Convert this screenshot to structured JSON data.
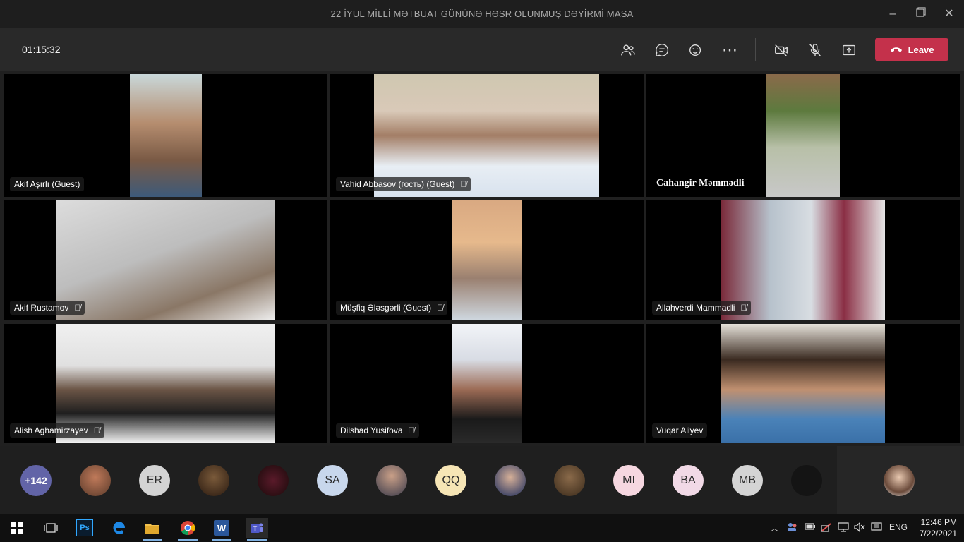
{
  "window": {
    "title": "22 İYUL MİLLİ MƏTBUAT GÜNÜNƏ HƏSR OLUNMUŞ DƏYİRMİ MASA",
    "minimize_icon": "minimize-icon",
    "restore_icon": "restore-icon",
    "close_icon": "close-icon"
  },
  "toolbar": {
    "timer": "01:15:32",
    "leave_label": "Leave",
    "leave_color": "#c4314b",
    "buttons": [
      "participants-icon",
      "chat-icon",
      "reactions-icon",
      "more-icon",
      "camera-off-icon",
      "mic-off-icon",
      "share-icon"
    ]
  },
  "tiles": [
    {
      "name": "Akif Aşırlı (Guest)",
      "muted": false
    },
    {
      "name": "Vahid Abbasov (гость) (Guest)",
      "muted": true
    },
    {
      "name": "Cahangir Məmmədli",
      "muted": false
    },
    {
      "name": "Akif Rustamov",
      "muted": true
    },
    {
      "name": "Müşfiq Ələsgərli (Guest)",
      "muted": true
    },
    {
      "name": "Allahverdi Mammadli",
      "muted": true
    },
    {
      "name": "Alish Aghamirzayev",
      "muted": true
    },
    {
      "name": "Dilshad Yusifova",
      "muted": true
    },
    {
      "name": "Vuqar Aliyev",
      "muted": false
    }
  ],
  "tray": {
    "overflow": "+142",
    "avatars": [
      "",
      "ER",
      "",
      "",
      "SA",
      "",
      "QQ",
      "",
      "",
      "MI",
      "BA",
      "MB",
      ""
    ]
  },
  "taskbar": {
    "apps": [
      "windows-icon",
      "task-view-icon",
      "photoshop-icon",
      "edge-icon",
      "file-explorer-icon",
      "chrome-icon",
      "word-icon",
      "teams-icon"
    ],
    "photoshop_label": "Ps",
    "word_label": "W",
    "language": "ENG",
    "time": "12:46 PM",
    "date": "7/22/2021"
  }
}
